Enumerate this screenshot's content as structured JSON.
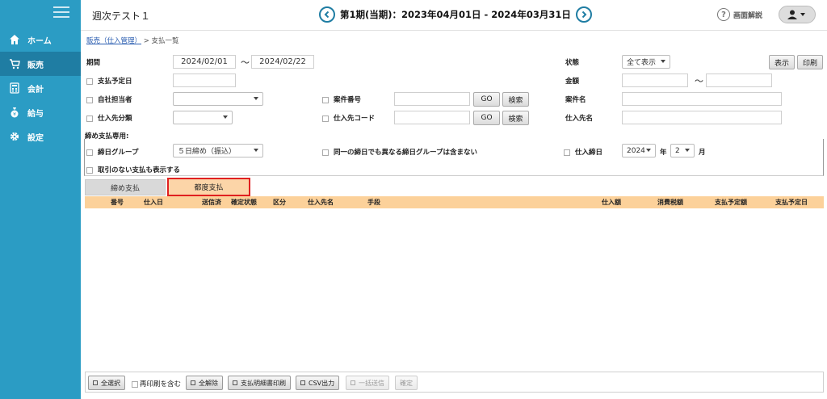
{
  "app": {
    "title": "週次テスト１"
  },
  "header": {
    "period": "第1期(当期)：2023年04月01日 - 2024年03月31日",
    "help_label": "画面解説"
  },
  "sidebar": {
    "items": [
      {
        "label": "ホーム",
        "icon": "home-icon"
      },
      {
        "label": "販売",
        "icon": "cart-icon",
        "active": true
      },
      {
        "label": "会計",
        "icon": "calculator-icon"
      },
      {
        "label": "給与",
        "icon": "money-bag-icon"
      },
      {
        "label": "設定",
        "icon": "gear-icon"
      }
    ]
  },
  "breadcrumb": {
    "parent": "販売（仕入管理）",
    "separator": ">",
    "current": "支払一覧"
  },
  "filters": {
    "period_label": "期間",
    "period_from": "2024/02/01",
    "period_sep": "〜",
    "period_to": "2024/02/22",
    "status_label": "状態",
    "status_value": "全て表示",
    "display_button": "表示",
    "print_button": "印刷",
    "pay_due_label": "支払予定日",
    "amount_label": "金額",
    "amount_sep": "〜",
    "staff_label": "自社担当者",
    "case_no_label": "案件番号",
    "case_name_label": "案件名",
    "go_label": "GO",
    "search_label": "検索",
    "supplier_cat_label": "仕入先分類",
    "supplier_code_label": "仕入先コード",
    "supplier_name_label": "仕入先名",
    "closing_section_label": "締め支払専用:",
    "closing_group_label": "締日グループ",
    "closing_group_value": "５日締め（振込）",
    "exclude_same_label": "同一の締日でも異なる締日グループは含まない",
    "purchase_close_label": "仕入締日",
    "year_value": "2024",
    "year_unit": "年",
    "month_value": "2",
    "month_unit": "月",
    "show_no_txn_label": "取引のない支払も表示する"
  },
  "tabs": {
    "closing": "締め支払",
    "each": "都度支払"
  },
  "table": {
    "columns": [
      "番号",
      "仕入日",
      "送信済",
      "確定状態",
      "区分",
      "仕入先名",
      "手段",
      "仕入額",
      "消費税額",
      "支払予定額",
      "支払予定日"
    ]
  },
  "footer": {
    "select_all": "全選択",
    "include_reprint": "再印刷を含む",
    "clear_all": "全解除",
    "print_detail": "支払明細書印刷",
    "csv_output": "CSV出力",
    "bulk_send": "一括送信",
    "confirm": "確定"
  },
  "colors": {
    "sidebar": "#2b9cc4",
    "sidebar_active": "#1f7da3",
    "table_header": "#fcd19a",
    "active_tab": "#fcd5a8",
    "highlight_border": "#e02020"
  }
}
